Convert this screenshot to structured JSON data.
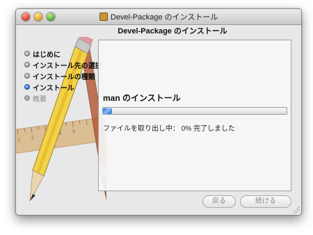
{
  "window": {
    "title": "Devel-Package のインストール",
    "header": "Devel-Package のインストール"
  },
  "sidebar": {
    "steps": [
      {
        "label": "はじめに",
        "state": "done"
      },
      {
        "label": "インストール先の選択",
        "state": "done"
      },
      {
        "label": "インストールの種類",
        "state": "done"
      },
      {
        "label": "インストール",
        "state": "current"
      },
      {
        "label": "概要",
        "state": "pending"
      }
    ]
  },
  "main": {
    "install_title": "man のインストール",
    "progress_percent": 5,
    "status_text": "ファイルを取り出し中： 0% 完了しました"
  },
  "buttons": {
    "back_label": "戻る",
    "continue_label": "続ける"
  },
  "artwork": {
    "ruler_ticks": [
      "1",
      "2",
      "3",
      "4",
      "5"
    ]
  },
  "colors": {
    "progress_fill": "#4b8fe0",
    "active_bullet": "#2a68d0"
  }
}
